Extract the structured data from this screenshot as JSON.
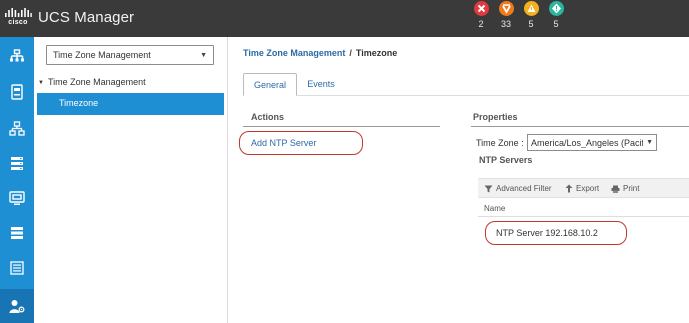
{
  "header": {
    "app_title": "UCS Manager",
    "logo_icon": "cisco-logo",
    "faults": [
      {
        "name": "critical",
        "icon": "critical-fault-icon",
        "color": "#e0393e",
        "count": "2"
      },
      {
        "name": "major",
        "icon": "major-fault-icon",
        "color": "#f07a1a",
        "count": "33"
      },
      {
        "name": "minor",
        "icon": "minor-fault-icon",
        "color": "#f4b01f",
        "count": "5"
      },
      {
        "name": "warning",
        "icon": "warning-fault-icon",
        "color": "#29b5a0",
        "count": "5"
      }
    ]
  },
  "rail": {
    "accent_color": "#1f8fd4",
    "items": [
      {
        "icon": "network-icon"
      },
      {
        "icon": "equipment-icon"
      },
      {
        "icon": "topology-icon"
      },
      {
        "icon": "storage-icon"
      },
      {
        "icon": "vm-icon"
      },
      {
        "icon": "server-list-icon"
      },
      {
        "icon": "chassis-list-icon"
      },
      {
        "icon": "admin-icon",
        "active": true
      }
    ]
  },
  "nav": {
    "filter_value": "Time Zone Management",
    "tree_root": "Time Zone Management",
    "tree_selected": "Timezone"
  },
  "content": {
    "breadcrumb": {
      "parent": "Time Zone Management",
      "separator": "/",
      "current": "Timezone"
    },
    "tabs": [
      {
        "label": "General",
        "active": true
      },
      {
        "label": "Events",
        "active": false
      }
    ],
    "actions": {
      "title": "Actions",
      "add_ntp_server": "Add NTP Server"
    },
    "properties": {
      "title": "Properties",
      "time_zone_label": "Time Zone :",
      "time_zone_value": "America/Los_Angeles (Pacif"
    },
    "ntp_servers": {
      "title": "NTP Servers",
      "toolbar": {
        "filter": "Advanced Filter",
        "export": "Export",
        "print": "Print"
      },
      "columns": [
        "Name"
      ],
      "rows": [
        {
          "name": "NTP Server 192.168.10.2"
        }
      ]
    },
    "highlight_color": "#c0392b"
  }
}
